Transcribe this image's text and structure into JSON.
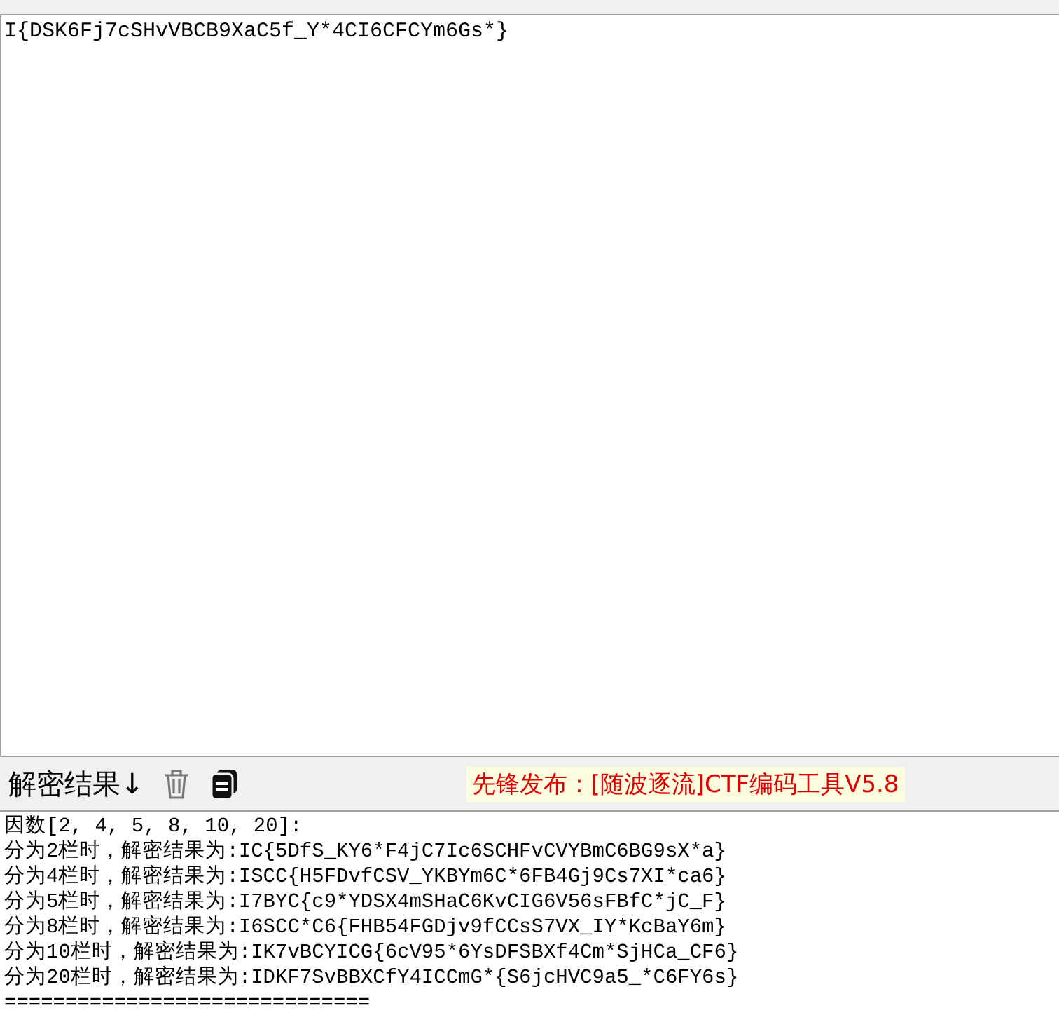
{
  "input": {
    "value": "I{DSK6Fj7cSHvVBCB9XaC5f_Y*4CI6CFCYm6Gs*}"
  },
  "toolbar": {
    "label": "解密结果↓",
    "banner": "先锋发布：[随波逐流]CTF编码工具V5.8"
  },
  "output": {
    "lines": [
      "因数[2, 4, 5, 8, 10, 20]:",
      "分为2栏时，解密结果为:IC{5DfS_KY6*F4jC7Ic6SCHFvCVYBmC6BG9sX*a}",
      "分为4栏时，解密结果为:ISCC{H5FDvfCSV_YKBYm6C*6FB4Gj9Cs7XI*ca6}",
      "分为5栏时，解密结果为:I7BYC{c9*YDSX4mSHaC6KvCIG6V56sFBfC*jC_F}",
      "分为8栏时，解密结果为:I6SCC*C6{FHB54FGDjv9fCCsS7VX_IY*KcBaY6m}",
      "分为10栏时，解密结果为:IK7vBCYICG{6cV95*6YsDFSBXf4Cm*SjHCa_CF6}",
      "分为20栏时，解密结果为:IDKF7SvBBXCfY4ICCmG*{S6jcHVC9a5_*C6FY6s}",
      "=============================="
    ]
  }
}
